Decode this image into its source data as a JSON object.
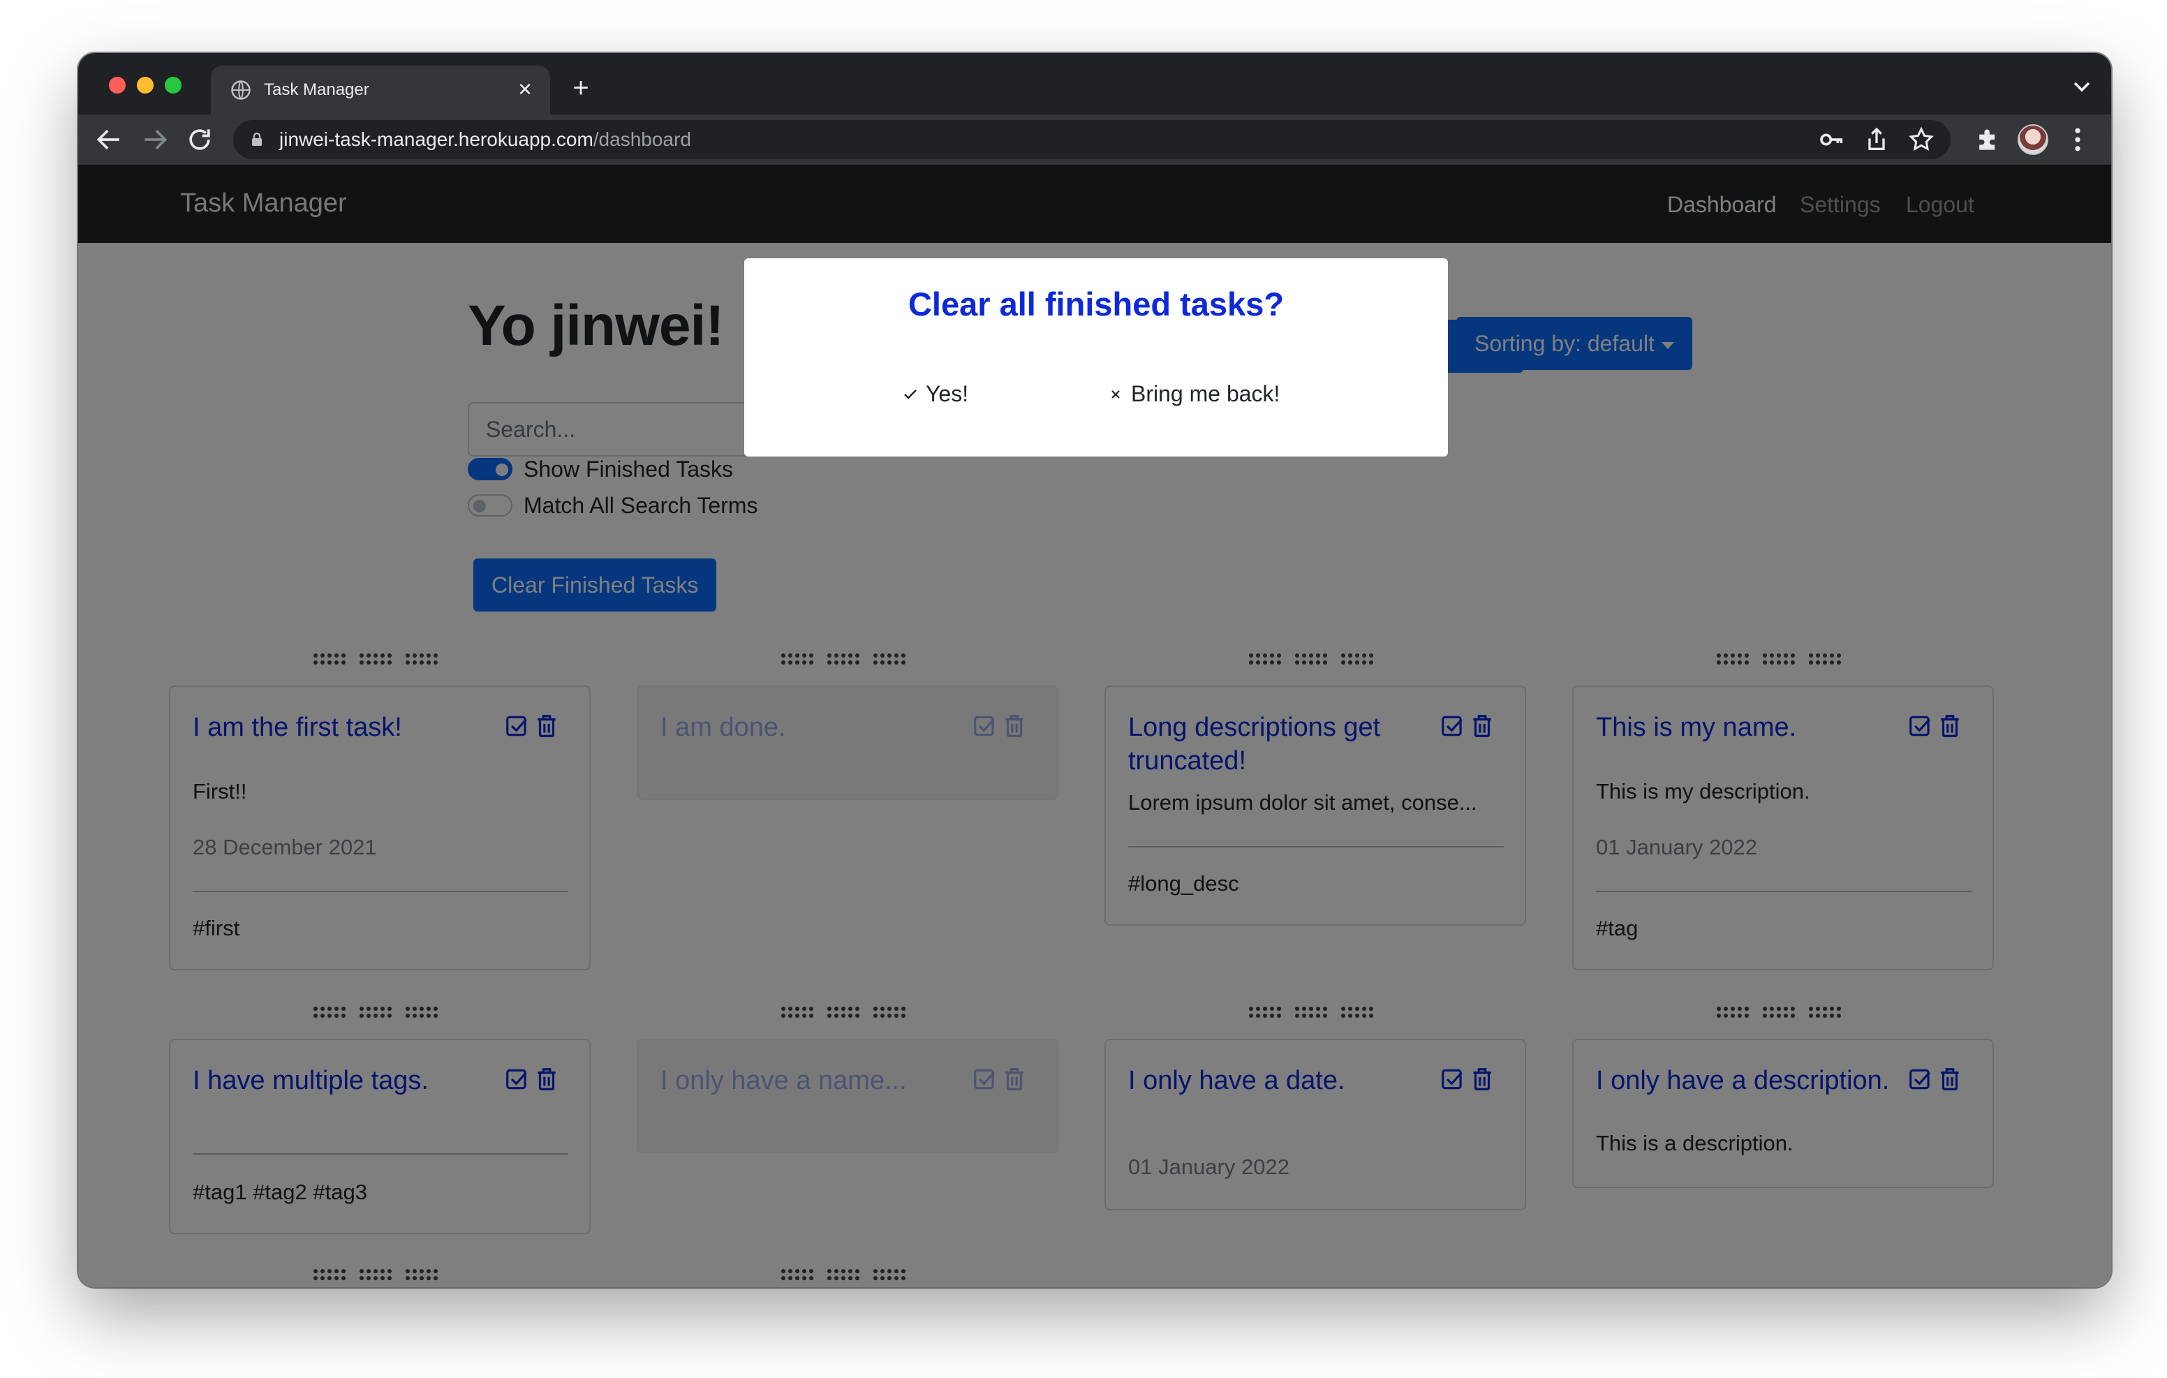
{
  "browser": {
    "tab_title": "Task Manager",
    "url_host": "jinwei-task-manager.herokuapp.com",
    "url_path": "/dashboard"
  },
  "navbar": {
    "brand": "Task Manager",
    "links": [
      "Dashboard",
      "Settings",
      "Logout"
    ],
    "active_link": "Dashboard"
  },
  "dashboard": {
    "greeting": "Yo jinwei!",
    "search_placeholder": "Search...",
    "toggles": [
      {
        "label": "Show Finished Tasks",
        "on": true
      },
      {
        "label": "Match All Search Terms",
        "on": false
      }
    ],
    "sort_label": "Sorting by: default",
    "clear_button": "Clear Finished Tasks"
  },
  "tasks": [
    {
      "title": "I am the first task!",
      "description": "First!!",
      "date": "28 December 2021",
      "tags": "#first",
      "done": false
    },
    {
      "title": "I am done.",
      "done": true
    },
    {
      "title": "Long descriptions get truncated!",
      "description": "Lorem ipsum dolor sit amet, conse...",
      "tags": "#long_desc",
      "done": false
    },
    {
      "title": "This is my name.",
      "description": "This is my description.",
      "date": "01 January 2022",
      "tags": "#tag",
      "done": false
    },
    {
      "title": "I have multiple tags.",
      "tags": "#tag1 #tag2 #tag3",
      "done": false
    },
    {
      "title": "I only have a name...",
      "done": true
    },
    {
      "title": "I only have a date.",
      "date": "01 January 2022",
      "done": false
    },
    {
      "title": "I only have a description.",
      "description": "This is a description.",
      "done": false
    }
  ],
  "modal": {
    "title": "Clear all finished tasks?",
    "confirm_label": "Yes!",
    "cancel_label": "Bring me back!"
  },
  "colors": {
    "primary": "#0d6efd",
    "task_title": "#0d29d9",
    "navbar_bg": "#212529"
  }
}
